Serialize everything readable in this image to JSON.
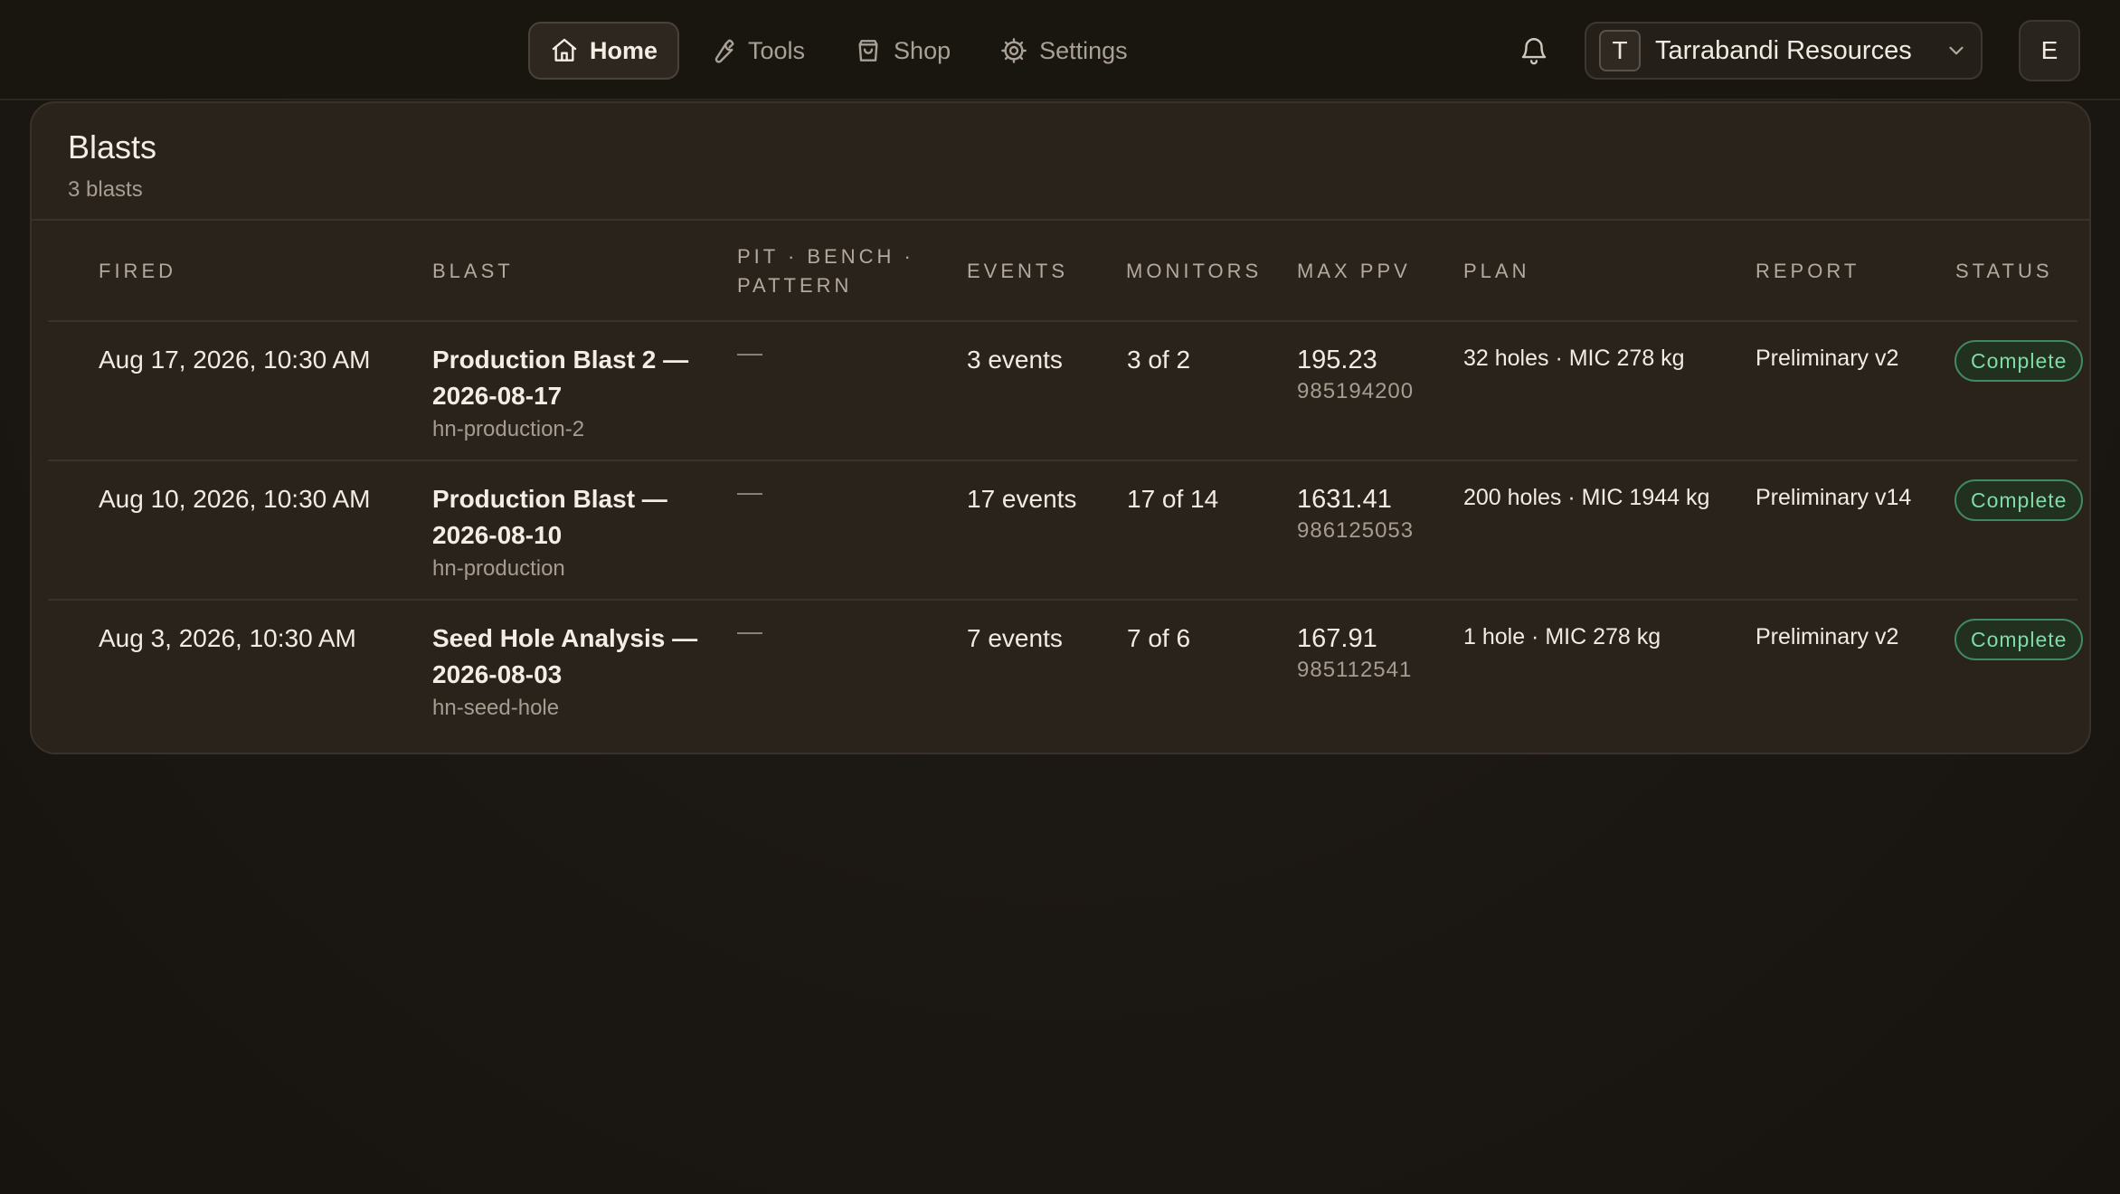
{
  "nav": {
    "items": [
      {
        "label": "Home",
        "icon": "home-icon",
        "active": true
      },
      {
        "label": "Tools",
        "icon": "wrench-icon",
        "active": false
      },
      {
        "label": "Shop",
        "icon": "shopping-bag-icon",
        "active": false
      },
      {
        "label": "Settings",
        "icon": "gear-icon",
        "active": false
      }
    ]
  },
  "header": {
    "org_initial": "T",
    "org_name": "Tarrabandi Resources",
    "user_initial": "E"
  },
  "card": {
    "title": "Blasts",
    "subtitle": "3 blasts"
  },
  "table": {
    "columns": [
      "FIRED",
      "BLAST",
      "PIT · BENCH · PATTERN",
      "EVENTS",
      "MONITORS",
      "MAX PPV",
      "PLAN",
      "REPORT",
      "STATUS"
    ],
    "rows": [
      {
        "fired": "Aug 17, 2026, 10:30 AM",
        "blast_name": "Production Blast 2 — 2026-08-17",
        "blast_id": "hn-production-2",
        "pit": "—",
        "events": "3 events",
        "monitors": "3 of 2",
        "max_ppv": "195.23",
        "ppv_serial": "985194200",
        "plan": "32 holes · MIC 278 kg",
        "report": "Preliminary v2",
        "status": "Complete"
      },
      {
        "fired": "Aug 10, 2026, 10:30 AM",
        "blast_name": "Production Blast — 2026-08-10",
        "blast_id": "hn-production",
        "pit": "—",
        "events": "17 events",
        "monitors": "17 of 14",
        "max_ppv": "1631.41",
        "ppv_serial": "986125053",
        "plan": "200 holes · MIC 1944 kg",
        "report": "Preliminary v14",
        "status": "Complete"
      },
      {
        "fired": "Aug 3, 2026, 10:30 AM",
        "blast_name": "Seed Hole Analysis — 2026-08-03",
        "blast_id": "hn-seed-hole",
        "pit": "—",
        "events": "7 events",
        "monitors": "7 of 6",
        "max_ppv": "167.91",
        "ppv_serial": "985112541",
        "plan": "1 hole · MIC 278 kg",
        "report": "Preliminary v2",
        "status": "Complete"
      }
    ]
  },
  "colors": {
    "background": "#1c1814",
    "card": "#2a231c",
    "status_complete": "#7fdca7"
  }
}
